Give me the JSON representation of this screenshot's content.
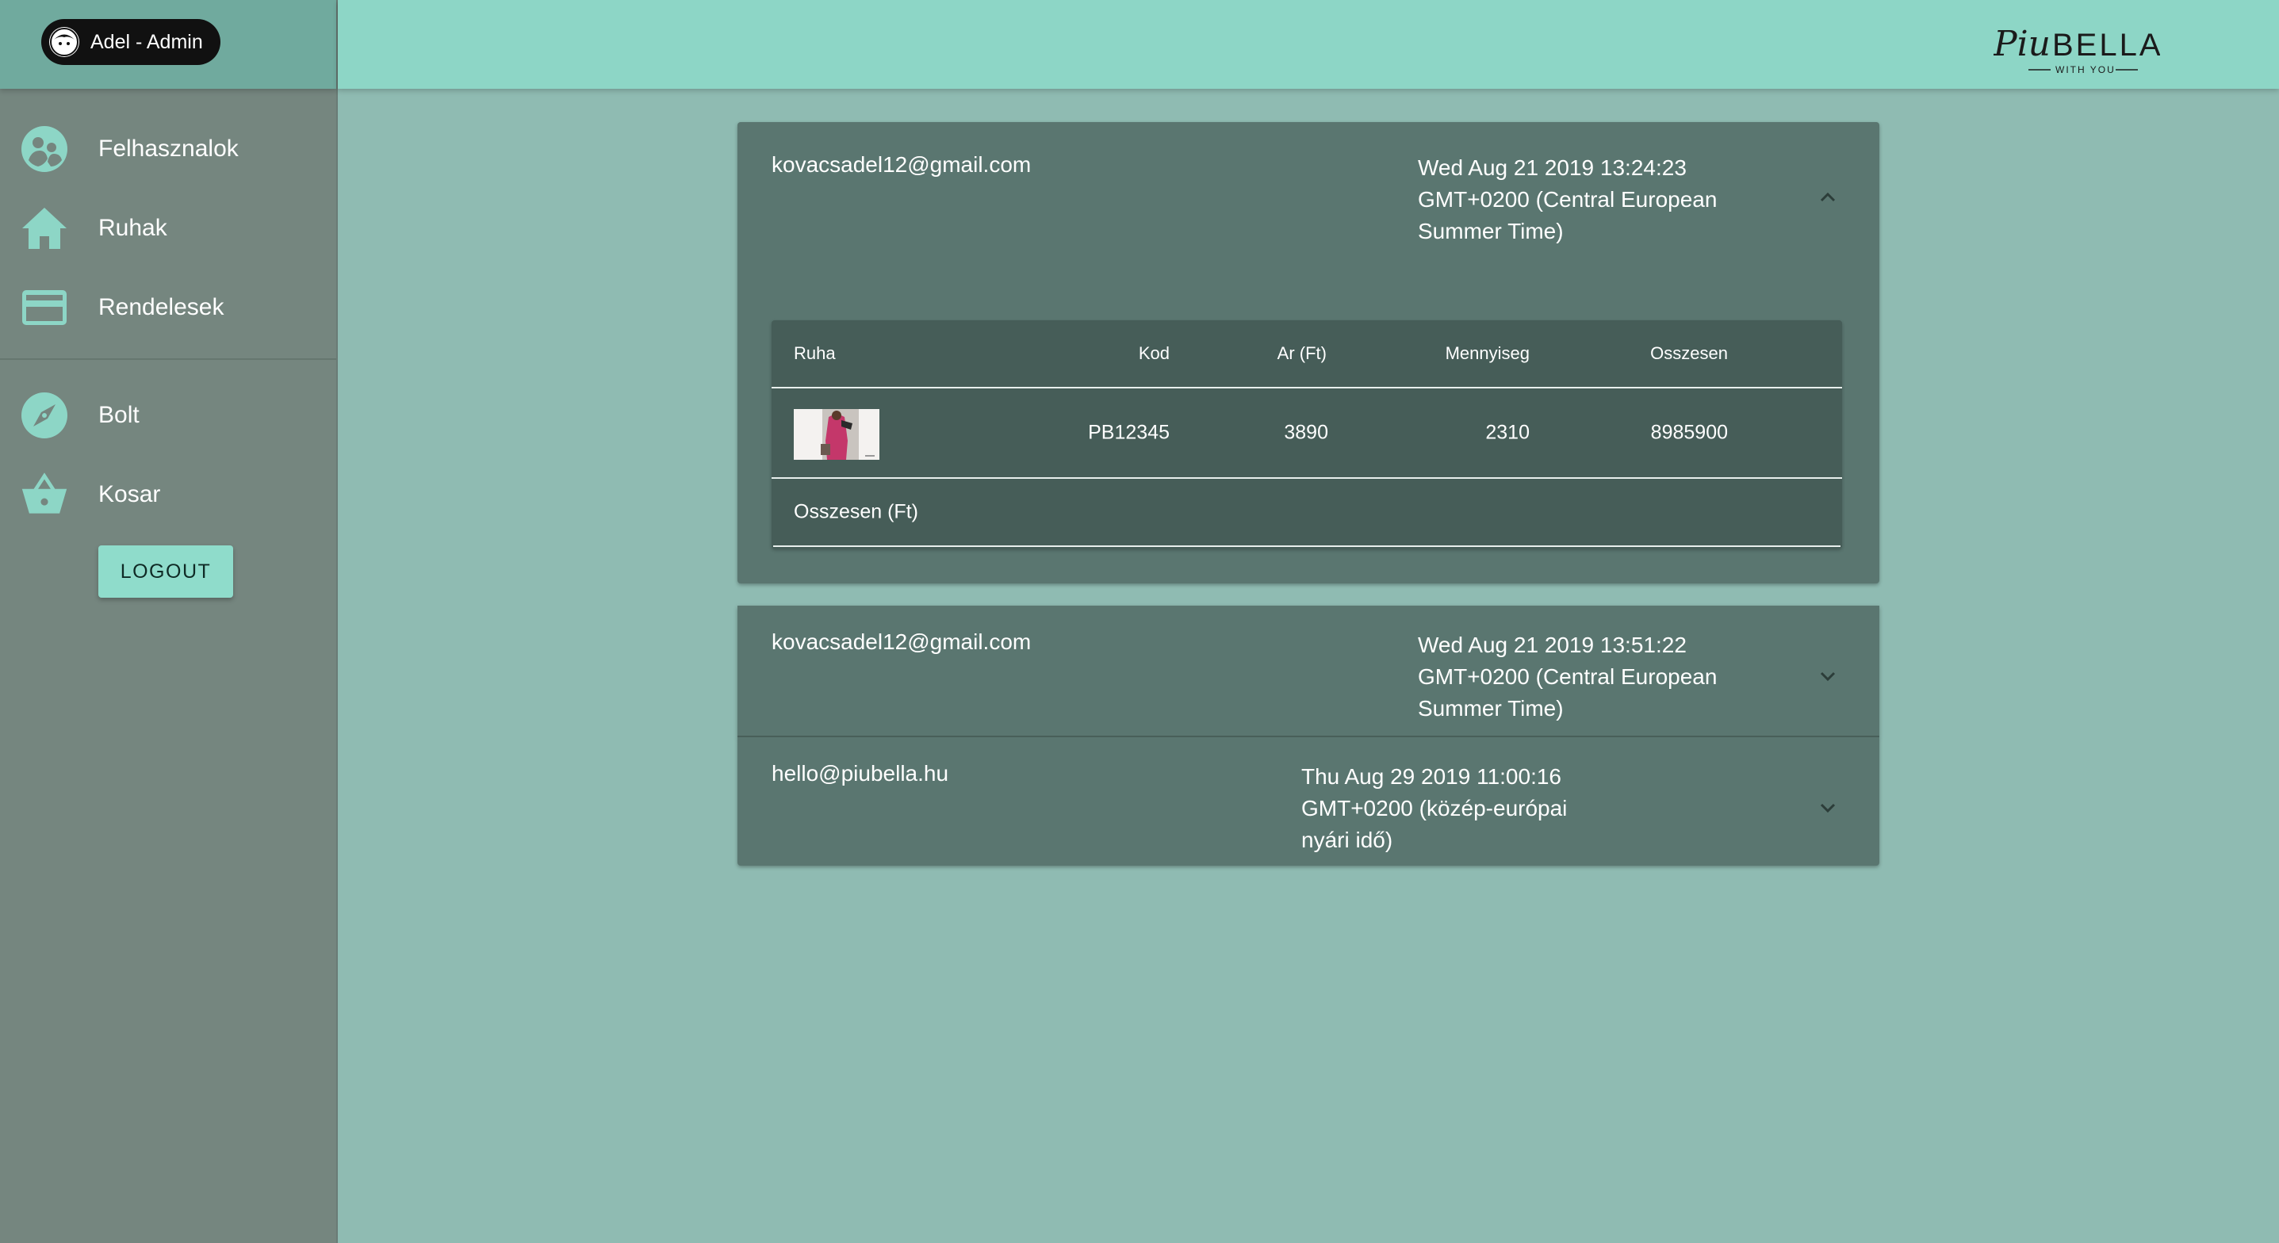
{
  "user": {
    "name": "Adel - Admin"
  },
  "brand": {
    "logo_script": "Piu",
    "logo_text": "BELLA",
    "tagline": "WITH YOU"
  },
  "sidebar": {
    "items": [
      {
        "label": "Felhasznalok",
        "icon": "users-icon"
      },
      {
        "label": "Ruhak",
        "icon": "home-icon"
      },
      {
        "label": "Rendelesek",
        "icon": "credit-card-icon"
      }
    ],
    "shop_items": [
      {
        "label": "Bolt",
        "icon": "compass-icon"
      },
      {
        "label": "Kosar",
        "icon": "basket-icon"
      }
    ],
    "logout_label": "LOGOUT"
  },
  "colors": {
    "accent": "#8dd6c6",
    "sidebar": "#75867f",
    "card": "#5a7670",
    "table": "#465d58"
  },
  "orders": [
    {
      "email": "kovacsadel12@gmail.com",
      "date": "Wed Aug 21 2019 13:24:23 GMT+0200 (Central European Summer Time)",
      "expanded": true,
      "table": {
        "headers": [
          "Ruha",
          "Kod",
          "Ar (Ft)",
          "Mennyiseg",
          "Osszesen"
        ],
        "rows": [
          {
            "kod": "PB12345",
            "ar": "3890",
            "mennyiseg": "2310",
            "osszesen": "8985900"
          }
        ],
        "total_label": "Osszesen (Ft)"
      }
    },
    {
      "email": "kovacsadel12@gmail.com",
      "date": "Wed Aug 21 2019 13:51:22 GMT+0200 (Central European Summer Time)",
      "expanded": false
    },
    {
      "email": "hello@piubella.hu",
      "date": "Thu Aug 29 2019 11:00:16 GMT+0200 (közép-európai nyári idő)",
      "expanded": false
    }
  ]
}
